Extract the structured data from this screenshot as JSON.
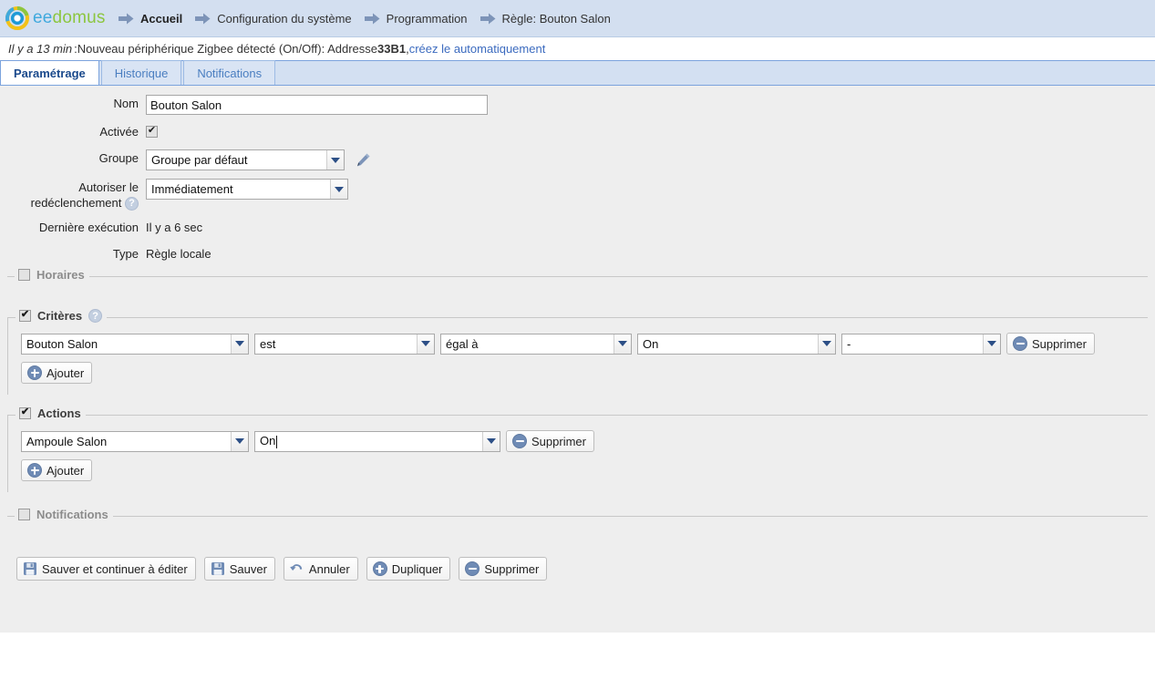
{
  "brand": {
    "name_part1": "ee",
    "name_part2": "domus",
    "logo_icon": "eedomus-ring-logo"
  },
  "breadcrumb": [
    {
      "label": "Accueil",
      "icon": "arrow-right-icon",
      "current": true
    },
    {
      "label": "Configuration du système",
      "icon": "arrow-right-icon",
      "current": false
    },
    {
      "label": "Programmation",
      "icon": "arrow-right-icon",
      "current": false
    },
    {
      "label": "Règle: Bouton Salon",
      "icon": "arrow-right-icon",
      "current": false
    }
  ],
  "notice": {
    "ago": "Il y a 13 min",
    "separator": " : ",
    "text_before": "Nouveau périphérique Zigbee détecté (On/Off): Addresse ",
    "address": "33B1",
    "comma": ", ",
    "link": "créez le automatiquement"
  },
  "tabs": [
    {
      "label": "Paramétrage",
      "active": true
    },
    {
      "label": "Historique",
      "active": false
    },
    {
      "label": "Notifications",
      "active": false
    }
  ],
  "form": {
    "nom_label": "Nom",
    "nom_value": "Bouton Salon",
    "activee_label": "Activée",
    "activee_checked": true,
    "groupe_label": "Groupe",
    "groupe_value": "Groupe par défaut",
    "groupe_edit_icon": "pencil-icon",
    "redecl_label_line1": "Autoriser le",
    "redecl_label_line2": "redéclenchement",
    "redecl_help_icon": "help-icon",
    "redecl_value": "Immédiatement",
    "derniere_label": "Dernière exécution",
    "derniere_value": "Il y a 6 sec",
    "type_label": "Type",
    "type_value": "Règle locale"
  },
  "sections": {
    "horaires": {
      "legend": "Horaires",
      "checked": false
    },
    "criteres": {
      "legend": "Critères",
      "checked": true,
      "help_icon": "help-icon",
      "rows": [
        {
          "device": "Bouton Salon",
          "verb": "est",
          "comparator": "égal à",
          "value": "On",
          "extra": "-",
          "delete_label": "Supprimer",
          "delete_icon": "minus-circle-icon"
        }
      ],
      "add_label": "Ajouter",
      "add_icon": "plus-circle-icon"
    },
    "actions": {
      "legend": "Actions",
      "checked": true,
      "rows": [
        {
          "device": "Ampoule Salon",
          "value": "On",
          "delete_label": "Supprimer",
          "delete_icon": "minus-circle-icon"
        }
      ],
      "add_label": "Ajouter",
      "add_icon": "plus-circle-icon"
    },
    "notifications": {
      "legend": "Notifications",
      "checked": false
    }
  },
  "footer_buttons": [
    {
      "label": "Sauver et continuer à éditer",
      "icon": "floppy-disk-icon"
    },
    {
      "label": "Sauver",
      "icon": "floppy-disk-icon"
    },
    {
      "label": "Annuler",
      "icon": "undo-arrow-icon"
    },
    {
      "label": "Dupliquer",
      "icon": "plus-circle-icon"
    },
    {
      "label": "Supprimer",
      "icon": "minus-circle-icon"
    }
  ],
  "colors": {
    "header_bg": "#d3dff0",
    "tabbar_bg": "#d3e0f2",
    "content_bg": "#eeeeee",
    "link": "#3c6bbf",
    "brand_blue": "#3fa9dd",
    "brand_green": "#8cc63f",
    "icon_blue": "#6f8bb5"
  }
}
